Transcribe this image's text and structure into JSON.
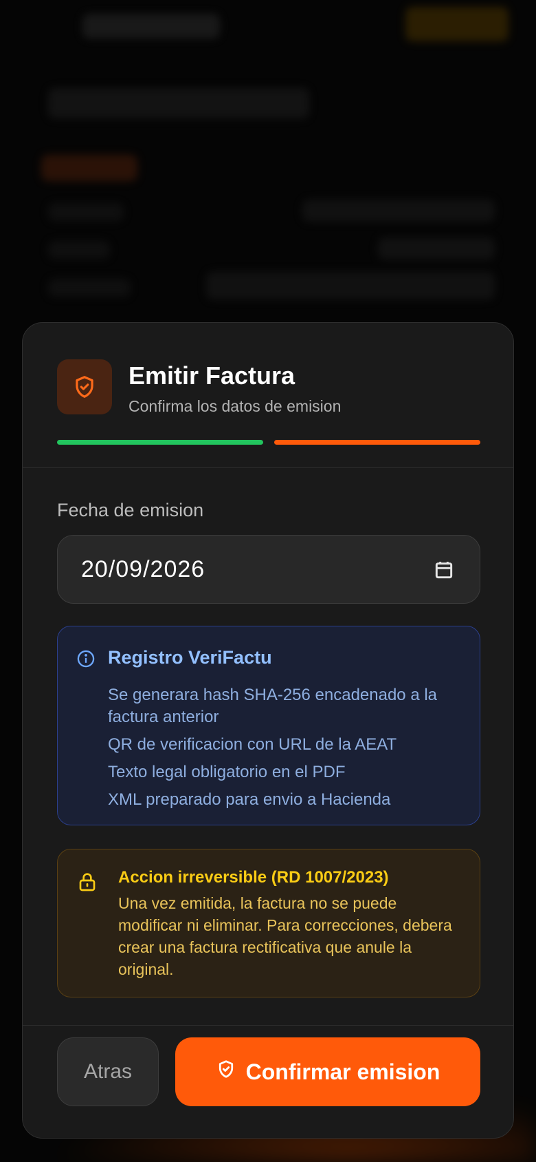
{
  "modal": {
    "title": "Emitir Factura",
    "subtitle": "Confirma los datos de emision",
    "steps": [
      {
        "state": "complete",
        "color": "#22c55e"
      },
      {
        "state": "current",
        "color": "#ff5a0a"
      }
    ]
  },
  "date_field": {
    "label": "Fecha de emision",
    "value": "20/09/2026"
  },
  "info_box": {
    "title": "Registro VeriFactu",
    "items": [
      "Se generara hash SHA-256 encadenado a la factura anterior",
      "QR de verificacion con URL de la AEAT",
      "Texto legal obligatorio en el PDF",
      "XML preparado para envio a Hacienda"
    ]
  },
  "warning_box": {
    "title": "Accion irreversible (RD 1007/2023)",
    "text": "Una vez emitida, la factura no se puede modificar ni eliminar. Para correcciones, debera crear una factura rectificativa que anule la original."
  },
  "footer": {
    "back_label": "Atras",
    "confirm_label": "Confirmar emision"
  },
  "icons": {
    "header": "shield-check-icon",
    "date": "calendar-icon",
    "info": "info-icon",
    "warning": "lock-icon",
    "confirm": "shield-check-icon"
  },
  "colors": {
    "accent": "#ff5a0a",
    "success": "#22c55e",
    "info": "#93c0ff",
    "warning": "#facc15"
  }
}
